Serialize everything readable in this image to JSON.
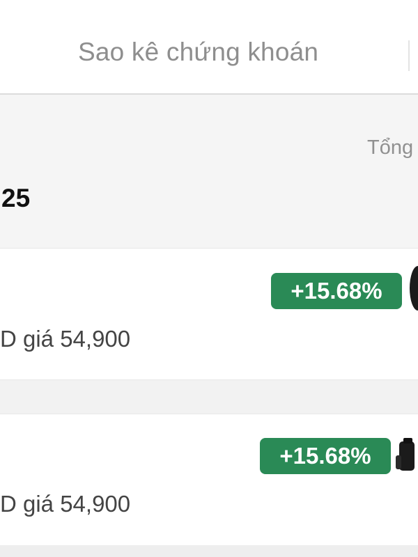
{
  "header": {
    "tab_label": "Sao kê chứng khoán"
  },
  "summary": {
    "right_label_partial": "Tổng",
    "value_partial": "25"
  },
  "holdings": [
    {
      "change_badge": "+15.68%",
      "price_text_partial": "D giá 54,900",
      "thumbnail": "dark-circular-thumbnail"
    },
    {
      "change_badge": "+15.68%",
      "price_text_partial": "D giá 54,900",
      "thumbnail": "dark-product-thumbnail"
    }
  ],
  "colors": {
    "positive_badge": "#2a8a56",
    "tab_text": "#8e8e8e",
    "background": "#f2f2f2"
  }
}
